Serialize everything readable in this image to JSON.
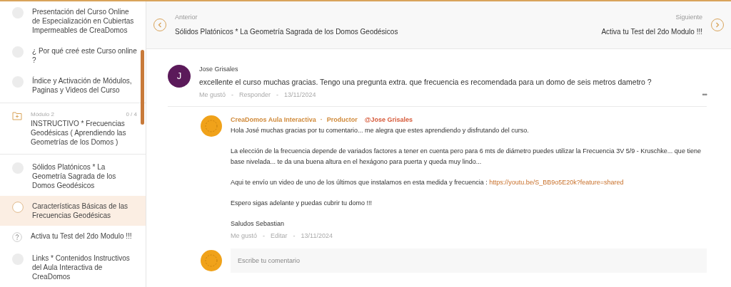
{
  "sidebar": {
    "items": [
      {
        "kind": "lesson",
        "title": "Presentación del Curso Online de Especialización en Cubiertas Impermeables de CreaDomos",
        "selected": false
      },
      {
        "kind": "lesson",
        "title": "¿ Por qué creé este Curso online ?",
        "selected": false
      },
      {
        "kind": "lesson",
        "title": "Índice y Activación de Módulos, Paginas y Videos del Curso",
        "selected": false
      },
      {
        "kind": "module",
        "label": "Módulo 2",
        "count": "0 / 4",
        "title": "INSTRUCTIVO * Frecuencias Geodésicas ( Aprendiendo las Geometrías de los Domos )",
        "selected": false
      },
      {
        "kind": "lesson",
        "title": "Sólidos Platónicos * La Geometría Sagrada de los Domos Geodésicos",
        "selected": false
      },
      {
        "kind": "lesson",
        "title": "Características Básicas de las Frecuencias Geodésicas",
        "selected": true
      },
      {
        "kind": "quiz",
        "title": "Activa tu Test del 2do Modulo !!!",
        "selected": false
      },
      {
        "kind": "lesson",
        "title": "Links * Contenidos Instructivos del Aula Interactiva de CreaDomos",
        "selected": false
      }
    ]
  },
  "nav": {
    "previous": {
      "label": "Anterior",
      "title": "Sólidos Platónicos * La Geometría Sagrada de los Domos Geodésicos"
    },
    "next": {
      "label": "Siguiente",
      "title": "Activa tu Test del 2do Modulo !!!"
    }
  },
  "comment": {
    "initial": "J",
    "author": "Jose Grisales",
    "text": "excellente el curso muchas gracias. Tengo una pregunta extra. que frecuencia es recomendada para un domo de seis metros dametro ?",
    "actions": [
      "Me gustó",
      "Responder"
    ],
    "separator": "-",
    "date": "13/11/2024",
    "more": "•••",
    "reply": {
      "author": "CreaDomos Aula Interactiva",
      "dot": "·",
      "role": "Productor",
      "mention": "@Jose Grisales",
      "paragraphs": [
        {
          "text": "Hola José muchas gracias por tu comentario... me alegra que estes aprendiendo y disfrutando del curso."
        },
        {
          "text": "La elección de la frecuencia depende de variados factores a tener en cuenta pero para 6 mts de diámetro puedes utilizar la Frecuencia 3V 5/9 - Kruschke... que tiene base nivelada... te da una buena altura en el hexágono para puerta y queda muy lindo..."
        },
        {
          "text": "Aqui te envío un video de uno de los últimos que instalamos en esta medida y frecuencia :",
          "link": "https://youtu.be/S_BB9o5E20k?feature=shared"
        },
        {
          "text": "Espero sigas adelante y puedas cubrir tu domo !!!"
        },
        {
          "text": "Saludos Sebastian"
        }
      ],
      "actions": [
        "Me gustó",
        "Editar"
      ],
      "separator": "-",
      "date": "13/11/2024"
    }
  },
  "composer": {
    "placeholder": "Escribe tu comentario"
  }
}
